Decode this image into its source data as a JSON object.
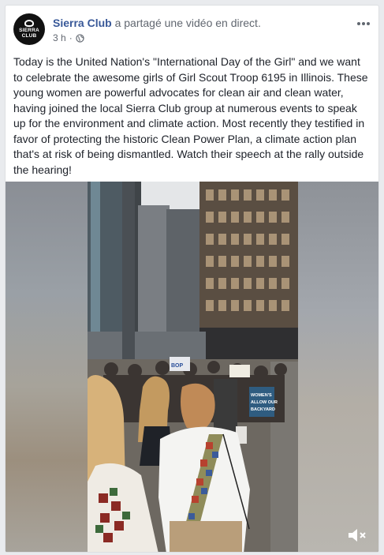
{
  "post": {
    "page_name": "Sierra Club",
    "action": "a partagé une vidéo en direct.",
    "time": "3 h",
    "separator": "·",
    "privacy_icon": "globe-icon",
    "more_icon": "more-options-icon",
    "avatar_text_line1": "SIERRA",
    "avatar_text_line2": "CLUB",
    "text": "Today is the United Nation's \"International Day of the Girl\" and we want to celebrate the awesome girls of Girl Scout Troop 6195 in Illinois. These young women are powerful advocates for clean air and clean water, having joined the local Sierra Club group at numerous events to speak up for the environment and climate action. Most recently they testified in favor of protecting the historic Clean Power Plan, a climate action plan that's at risk of being dismantled. Watch their speech at the rally outside the hearing!"
  },
  "video": {
    "mute_icon": "volume-muted-icon",
    "sign_text_1": "BOP",
    "sign_text_2": "WOMEN'S",
    "sign_text_3": "ALLOW OUR",
    "sign_text_4": "BACKYARD"
  },
  "colors": {
    "link": "#385898",
    "meta": "#616770",
    "text": "#1d2129",
    "background": "#e9ebee"
  }
}
